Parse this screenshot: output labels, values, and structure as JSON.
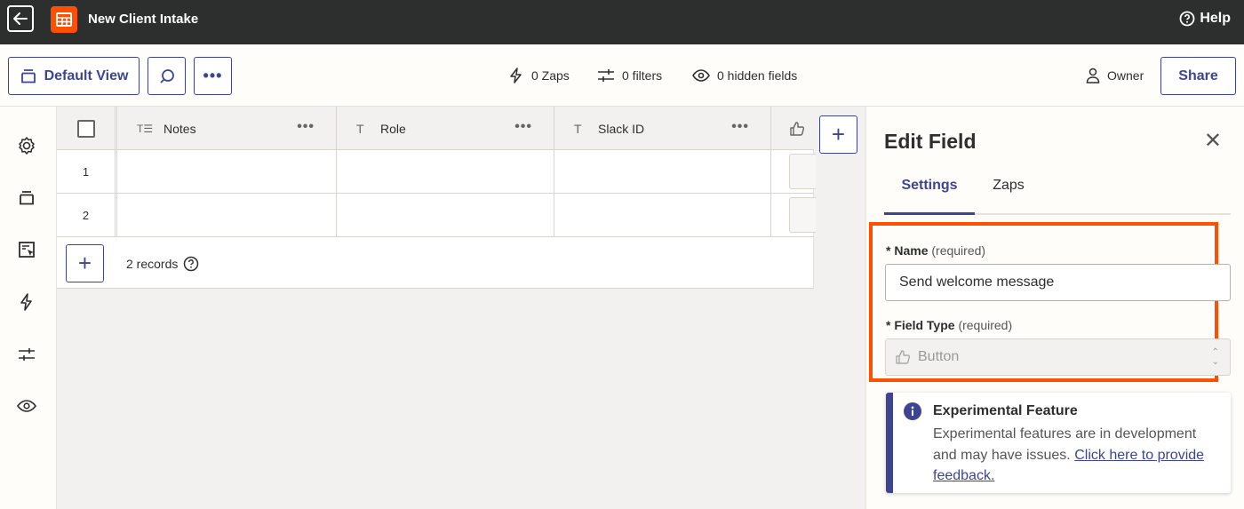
{
  "app": {
    "title": "New Client Intake",
    "help": "Help"
  },
  "toolbar": {
    "view_label": "Default View",
    "zaps": "0 Zaps",
    "filters": "0 filters",
    "hidden": "0 hidden fields",
    "owner": "Owner",
    "share": "Share"
  },
  "table": {
    "columns": [
      {
        "label": "Notes",
        "type_icon": "long-text-icon"
      },
      {
        "label": "Role",
        "type_icon": "text-icon"
      },
      {
        "label": "Slack ID",
        "type_icon": "text-icon"
      }
    ],
    "rows": [
      "1",
      "2"
    ],
    "records": "2 records"
  },
  "panel": {
    "title": "Edit Field",
    "tabs": [
      "Settings",
      "Zaps"
    ],
    "name_label": "Name",
    "required": "(required)",
    "name_value": "Send welcome message",
    "type_label": "Field Type",
    "type_value": "Button",
    "callout_title": "Experimental Feature",
    "callout_body": "Experimental features are in development and may have issues.",
    "callout_link": "Click here to provide feedback."
  },
  "colors": {
    "accent": "#3d4592",
    "brand": "#ff4f00",
    "topbar": "#2d2e2e"
  }
}
